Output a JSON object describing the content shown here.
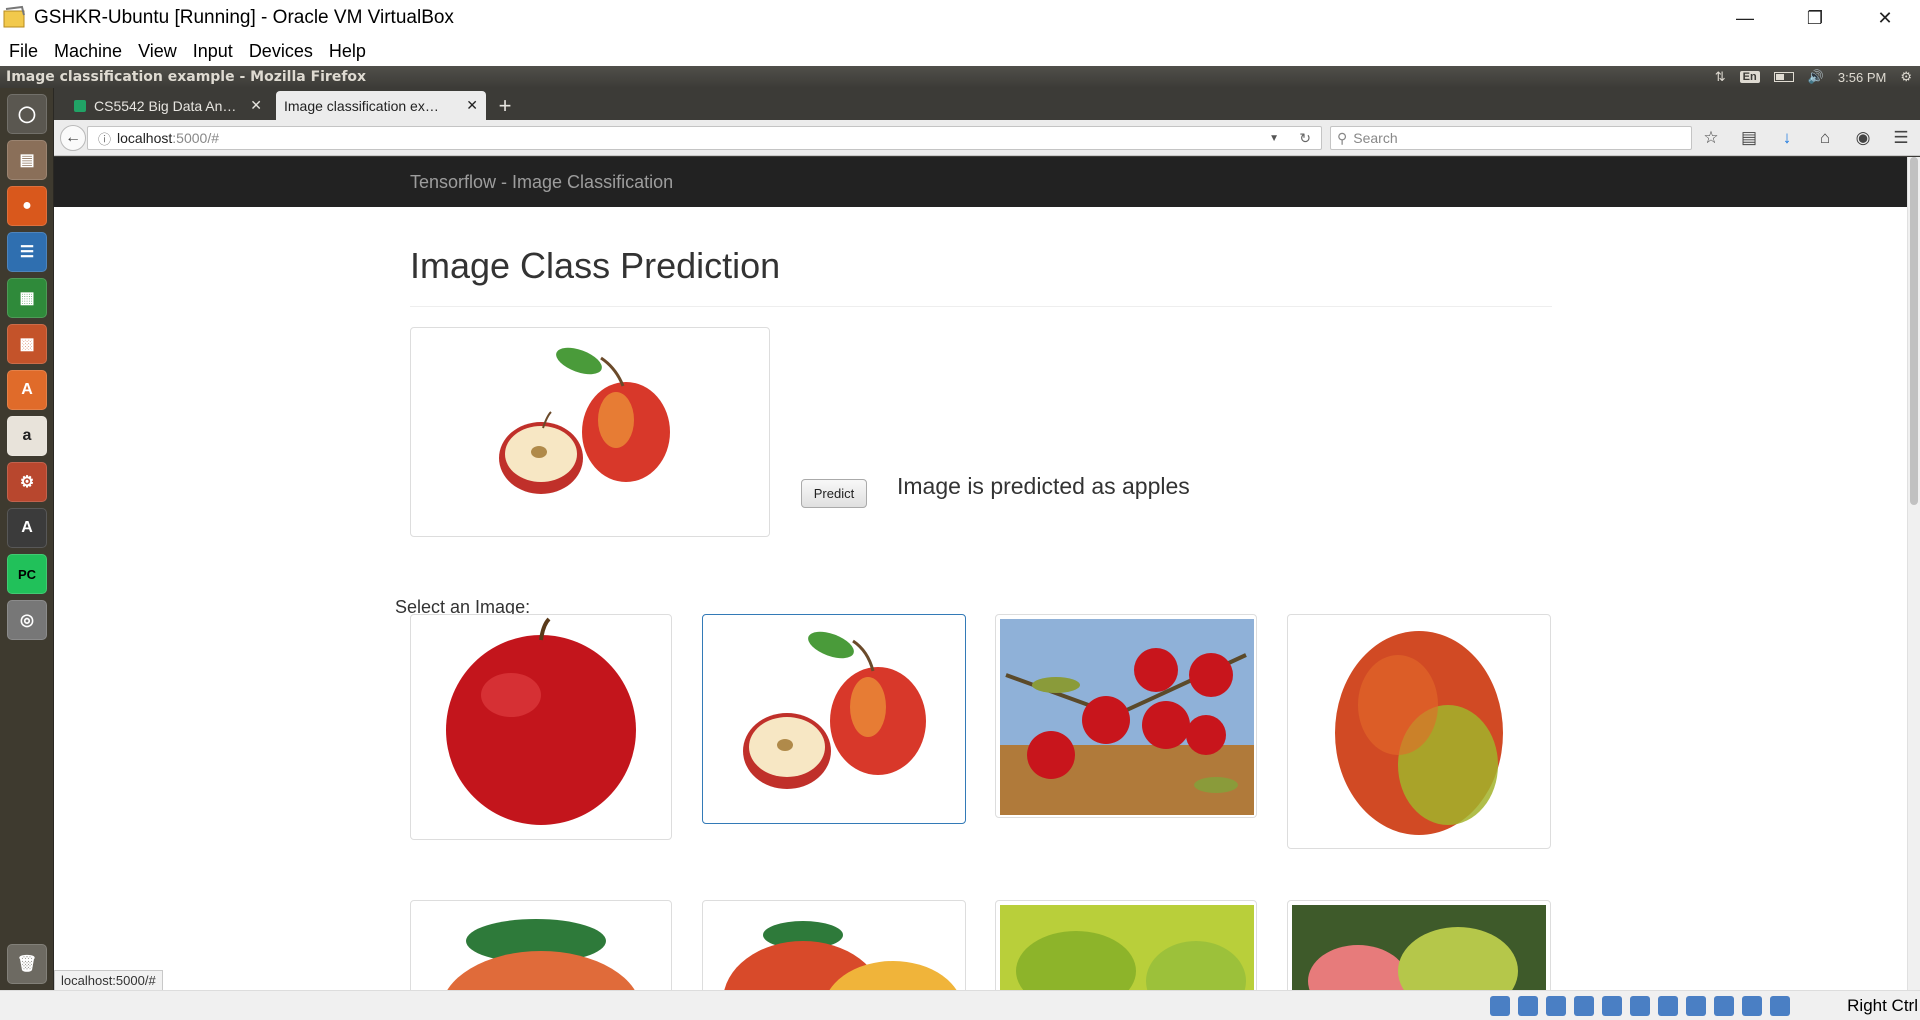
{
  "virtualbox": {
    "title": "GSHKR-Ubuntu [Running] - Oracle VM VirtualBox",
    "menu": [
      "File",
      "Machine",
      "View",
      "Input",
      "Devices",
      "Help"
    ],
    "host_key": "Right Ctrl"
  },
  "ubuntu": {
    "window_title": "Image classification example - Mozilla Firefox",
    "keyboard_layout": "En",
    "clock": "3:56 PM"
  },
  "browser": {
    "tabs": [
      {
        "label": "CS5542 Big Data An…"
      },
      {
        "label": "Image classification ex…"
      }
    ],
    "url_host": "localhost",
    "url_path": ":5000/#",
    "search_placeholder": "Search",
    "status_url": "localhost:5000/#"
  },
  "page": {
    "brand": "Tensorflow - Image Classification",
    "heading": "Image Class Prediction",
    "predict_button": "Predict",
    "result": "Image is predicted as apples",
    "select_label": "Select an Image:"
  },
  "colors": {
    "navbar": "#222222",
    "selected_border": "#337ab7",
    "launcher": "#3e3a2f"
  }
}
